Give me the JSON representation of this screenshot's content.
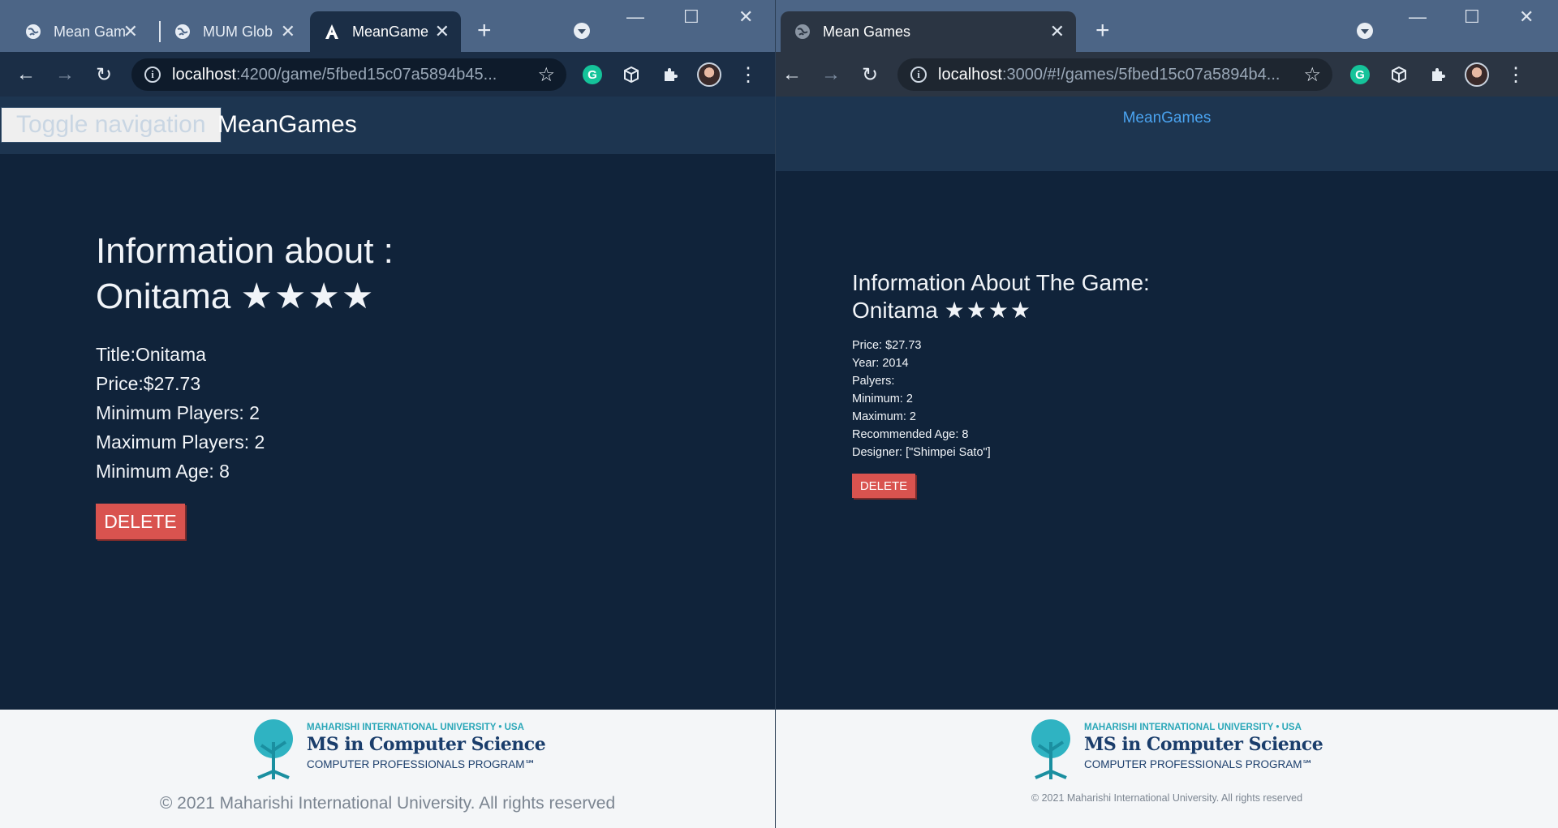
{
  "left_window": {
    "tabs": [
      {
        "title": "Mean Gam",
        "favicon": "globe-icon"
      },
      {
        "title": "MUM Glob",
        "favicon": "globe-icon"
      },
      {
        "title": "MeanGame",
        "favicon": "angular-icon",
        "active": true
      }
    ],
    "address": {
      "host": "localhost",
      "path": ":4200/game/5fbed15c07a5894b45..."
    },
    "navbar": {
      "toggle_label": "Toggle navigation",
      "brand": "MeanGames"
    },
    "heading_line1": "Information about :",
    "heading_line2": "Onitama",
    "rating_stars": "★★★★",
    "details": [
      "Title:Onitama",
      "Price:$27.73",
      "Minimum Players: 2",
      "Maximum Players: 2",
      "Minimum Age: 8"
    ],
    "delete_label": "DELETE",
    "footer": {
      "logo_line1": "MAHARISHI INTERNATIONAL UNIVERSITY • USA",
      "logo_line2": "MS in Computer Science",
      "logo_line3": "COMPUTER PROFESSIONALS PROGRAM℠",
      "copyright": "© 2021 Maharishi International University. All rights reserved"
    }
  },
  "right_window": {
    "tabs": [
      {
        "title": "Mean Games",
        "favicon": "globe-icon",
        "active": true
      }
    ],
    "address": {
      "host": "localhost",
      "path": ":3000/#!/games/5fbed15c07a5894b4..."
    },
    "navbar": {
      "brand": "MeanGames"
    },
    "heading_line1": "Information About The Game:",
    "heading_line2": "Onitama",
    "rating_stars": "★★★★",
    "details": [
      "Price: $27.73",
      "Year: 2014",
      "Palyers:",
      "Minimum: 2",
      "Maximum: 2",
      "Recommended Age: 8",
      "Designer: [\"Shimpei Sato\"]"
    ],
    "delete_label": "DELETE",
    "footer": {
      "logo_line1": "MAHARISHI INTERNATIONAL UNIVERSITY • USA",
      "logo_line2": "MS in Computer Science",
      "logo_line3": "COMPUTER PROFESSIONALS PROGRAM℠",
      "copyright": "© 2021 Maharishi International University. All rights reserved"
    }
  },
  "colors": {
    "page_bg": "#10233a",
    "navbar_bg": "#1d3550",
    "delete_button": "#d9534f",
    "brand_link": "#4aa3f0",
    "footer_bg": "#f4f6f8"
  }
}
